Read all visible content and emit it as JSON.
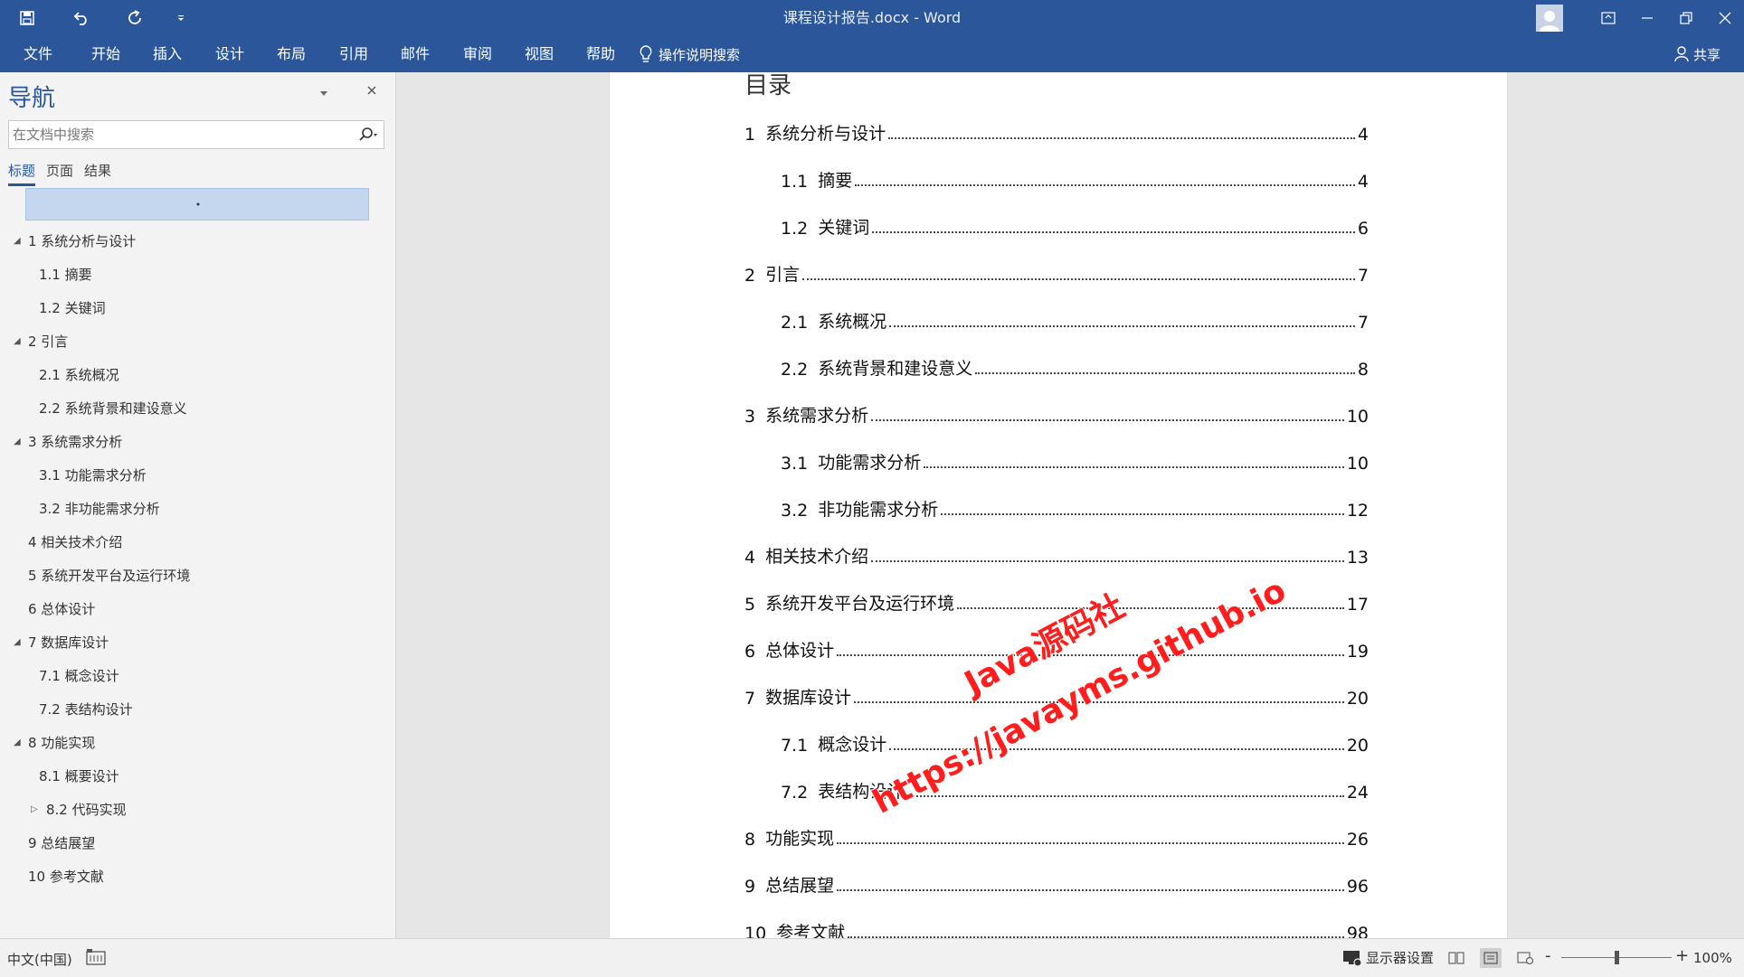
{
  "titlebar": {
    "document_title": "课程设计报告.docx  -  Word"
  },
  "ribbon": {
    "tabs": [
      "文件",
      "开始",
      "插入",
      "设计",
      "布局",
      "引用",
      "邮件",
      "审阅",
      "视图",
      "帮助"
    ],
    "tell_me": "操作说明搜索",
    "share": "共享"
  },
  "nav": {
    "title": "导航",
    "search_placeholder": "在文档中搜索",
    "tabs": [
      "标题",
      "页面",
      "结果"
    ],
    "items": [
      {
        "label": "1 系统分析与设计",
        "level": 1,
        "expand": "expanded"
      },
      {
        "label": "1.1 摘要",
        "level": 2,
        "expand": "none"
      },
      {
        "label": "1.2 关键词",
        "level": 2,
        "expand": "none"
      },
      {
        "label": "2 引言",
        "level": 1,
        "expand": "expanded"
      },
      {
        "label": "2.1 系统概况",
        "level": 2,
        "expand": "none"
      },
      {
        "label": "2.2 系统背景和建设意义",
        "level": 2,
        "expand": "none"
      },
      {
        "label": "3 系统需求分析",
        "level": 1,
        "expand": "expanded"
      },
      {
        "label": "3.1 功能需求分析",
        "level": 2,
        "expand": "none"
      },
      {
        "label": "3.2 非功能需求分析",
        "level": 2,
        "expand": "none"
      },
      {
        "label": "4 相关技术介绍",
        "level": 1,
        "expand": "none"
      },
      {
        "label": "5 系统开发平台及运行环境",
        "level": 1,
        "expand": "none"
      },
      {
        "label": "6 总体设计",
        "level": 1,
        "expand": "none"
      },
      {
        "label": "7 数据库设计",
        "level": 1,
        "expand": "expanded"
      },
      {
        "label": "7.1 概念设计",
        "level": 2,
        "expand": "none"
      },
      {
        "label": "7.2 表结构设计",
        "level": 2,
        "expand": "none"
      },
      {
        "label": "8 功能实现",
        "level": 1,
        "expand": "expanded"
      },
      {
        "label": "8.1 概要设计",
        "level": 2,
        "expand": "none"
      },
      {
        "label": "8.2 代码实现",
        "level": 2,
        "expand": "collapsed"
      },
      {
        "label": "9 总结展望",
        "level": 1,
        "expand": "none"
      },
      {
        "label": "10 参考文献",
        "level": 1,
        "expand": "none"
      }
    ]
  },
  "document": {
    "toc_heading": "目录",
    "toc": [
      {
        "num": "1",
        "title": "系统分析与设计",
        "page": "4",
        "level": 1
      },
      {
        "num": "1.1",
        "title": "摘要",
        "page": "4",
        "level": 2
      },
      {
        "num": "1.2",
        "title": "关键词",
        "page": "6",
        "level": 2
      },
      {
        "num": "2",
        "title": "引言",
        "page": "7",
        "level": 1
      },
      {
        "num": "2.1",
        "title": "系统概况",
        "page": "7",
        "level": 2
      },
      {
        "num": "2.2",
        "title": "系统背景和建设意义",
        "page": "8",
        "level": 2
      },
      {
        "num": "3",
        "title": "系统需求分析",
        "page": "10",
        "level": 1
      },
      {
        "num": "3.1",
        "title": "功能需求分析",
        "page": "10",
        "level": 2
      },
      {
        "num": "3.2",
        "title": "非功能需求分析",
        "page": "12",
        "level": 2
      },
      {
        "num": "4",
        "title": "相关技术介绍",
        "page": "13",
        "level": 1
      },
      {
        "num": "5",
        "title": "系统开发平台及运行环境",
        "page": "17",
        "level": 1
      },
      {
        "num": "6",
        "title": "总体设计",
        "page": "19",
        "level": 1
      },
      {
        "num": "7",
        "title": "数据库设计",
        "page": "20",
        "level": 1
      },
      {
        "num": "7.1",
        "title": "概念设计",
        "page": "20",
        "level": 2
      },
      {
        "num": "7.2",
        "title": "表结构设计",
        "page": "24",
        "level": 2
      },
      {
        "num": "8",
        "title": "功能实现",
        "page": "26",
        "level": 1
      },
      {
        "num": "9",
        "title": "总结展望",
        "page": "96",
        "level": 1
      },
      {
        "num": "10",
        "title": "参考文献",
        "page": "98",
        "level": 1
      }
    ],
    "watermark_line1": "Java源码社",
    "watermark_line2": "https://javayms.github.io"
  },
  "statusbar": {
    "language": "中文(中国)",
    "display_settings": "显示器设置",
    "zoom_level": "100%",
    "zoom_fraction": 0.5
  },
  "colors": {
    "brand": "#2b579a",
    "nav_highlight": "#c5d7ef",
    "watermark": "#ff1d1d"
  }
}
